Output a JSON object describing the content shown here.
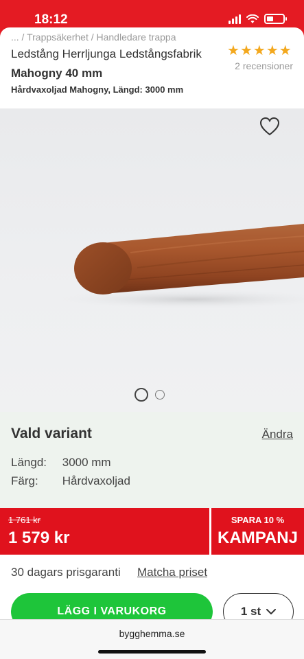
{
  "status": {
    "time": "18:12"
  },
  "product": {
    "breadcrumb": "... / Trappsäkerhet / Handledare trappa",
    "title": "Ledstång Herrljunga Ledstångsfabrik",
    "subtitle": "Mahogny 40 mm",
    "spec": "Hårdvaxoljad Mahogny, Längd: 3000 mm",
    "rating": 5,
    "reviews": "2 recensioner"
  },
  "gallery": {
    "images": 2,
    "active_index": 0
  },
  "variant": {
    "title": "Vald variant",
    "change_label": "Ändra",
    "rows": [
      {
        "label": "Längd:",
        "value": "3000 mm"
      },
      {
        "label": "Färg:",
        "value": "Hårdvaxoljad"
      }
    ]
  },
  "price": {
    "old": "1 761 kr",
    "current": "1 579 kr",
    "save": "SPARA 10 %",
    "campaign": "KAMPANJ"
  },
  "guarantee": {
    "text": "30 dagars prisgaranti",
    "link": "Matcha priset"
  },
  "cart": {
    "button_label": "LÄGG I VARUKORG",
    "quantity": "1 st"
  },
  "browser": {
    "url": "bygghemma.se"
  },
  "colors": {
    "brand_red": "#e0121d",
    "cart_green": "#1ec53a",
    "star": "#f3a81e"
  }
}
